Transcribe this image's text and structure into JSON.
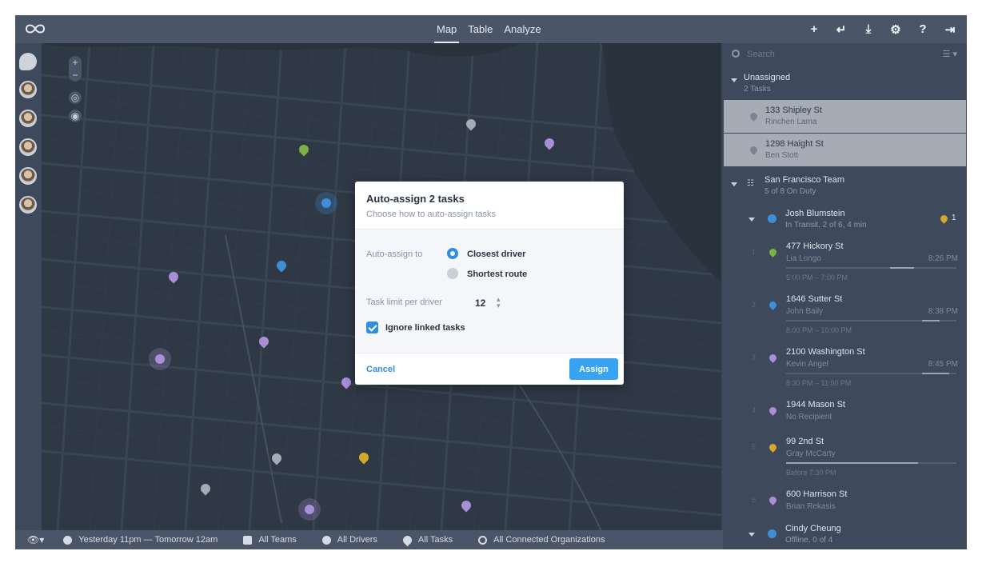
{
  "nav": {
    "tabs": [
      {
        "label": "Map"
      },
      {
        "label": "Table"
      },
      {
        "label": "Analyze"
      }
    ],
    "active": "Map"
  },
  "top_icons": [
    "add-icon",
    "import-icon",
    "download-icon",
    "settings-icon",
    "help-icon",
    "logout-icon"
  ],
  "search": {
    "placeholder": "Search"
  },
  "panel": {
    "unassigned": {
      "title": "Unassigned",
      "sub": "2 Tasks",
      "tasks": [
        {
          "address": "133 Shipley St",
          "recipient": "Rinchen Lama"
        },
        {
          "address": "1298 Haight St",
          "recipient": "Ben Stott"
        }
      ]
    },
    "team": {
      "title": "San Francisco Team",
      "sub": "5 of 8 On Duty"
    },
    "driver1": {
      "name": "Josh Blumstein",
      "status": "In Transit, 2 of 6, 4 min",
      "count": "1"
    },
    "tasks": [
      {
        "num": "1",
        "address": "477 Hickory St",
        "recipient": "Lia Longo",
        "eta": "8:26 PM",
        "window": "5:00 PM – 7:00 PM",
        "color": "#7cb342"
      },
      {
        "num": "2",
        "address": "1646 Sutter St",
        "recipient": "John Baily",
        "eta": "8:38 PM",
        "window": "8:00 PM – 10:00 PM",
        "color": "#3f8fd8"
      },
      {
        "num": "3",
        "address": "2100 Washington St",
        "recipient": "Kevin Angel",
        "eta": "8:45 PM",
        "window": "8:30 PM – 11:00 PM",
        "color": "#a98fd8"
      },
      {
        "num": "4",
        "address": "1944 Mason St",
        "recipient": "No Recipient",
        "eta": "",
        "window": "",
        "color": "#a98fd8"
      },
      {
        "num": "5",
        "address": "99 2nd St",
        "recipient": "Gray McCarty",
        "eta": "",
        "window": "Before 7:30 PM",
        "color": "#d4a82a"
      },
      {
        "num": "6",
        "address": "600 Harrison St",
        "recipient": "Brian Rekasis",
        "eta": "",
        "window": "",
        "color": "#a98fd8"
      }
    ],
    "driver2": {
      "name": "Cindy Cheung",
      "status": "Offline, 0 of 4"
    }
  },
  "modal": {
    "title": "Auto-assign 2 tasks",
    "subtitle": "Choose how to auto-assign tasks",
    "assign_to_label": "Auto-assign to",
    "option_closest": "Closest driver",
    "option_shortest": "Shortest route",
    "limit_label": "Task limit per driver",
    "limit_value": "12",
    "ignore_linked": "Ignore linked tasks",
    "cancel": "Cancel",
    "assign": "Assign"
  },
  "bottombar": {
    "time": "Yesterday 11pm — Tomorrow 12am",
    "teams": "All Teams",
    "drivers": "All Drivers",
    "tasks": "All Tasks",
    "orgs": "All Connected Organizations"
  },
  "colors": {
    "accent": "#38a3f1",
    "purple_pin": "#a98fd8",
    "green_pin": "#7cb342",
    "blue_pin": "#3f8fd8",
    "gray_pin": "#a5acb6",
    "yellow_pin": "#d4a82a"
  }
}
